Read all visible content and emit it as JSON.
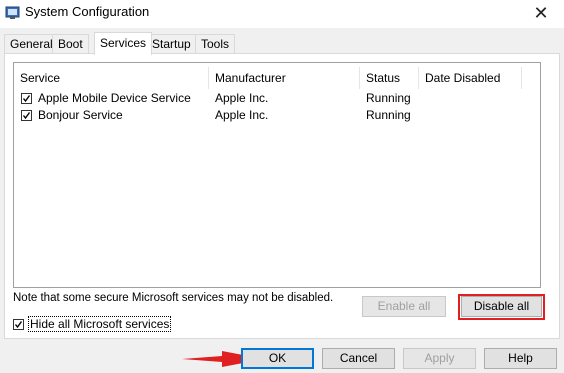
{
  "window": {
    "title": "System Configuration"
  },
  "tabs": [
    {
      "label": "General"
    },
    {
      "label": "Boot"
    },
    {
      "label": "Services"
    },
    {
      "label": "Startup"
    },
    {
      "label": "Tools"
    }
  ],
  "columns": [
    "Service",
    "Manufacturer",
    "Status",
    "Date Disabled"
  ],
  "services": [
    {
      "checked": true,
      "name": "Apple Mobile Device Service",
      "manufacturer": "Apple Inc.",
      "status": "Running",
      "date_disabled": ""
    },
    {
      "checked": true,
      "name": "Bonjour Service",
      "manufacturer": "Apple Inc.",
      "status": "Running",
      "date_disabled": ""
    }
  ],
  "note": "Note that some secure Microsoft services may not be disabled.",
  "buttons": {
    "enable_all": "Enable all",
    "disable_all": "Disable all",
    "ok": "OK",
    "cancel": "Cancel",
    "apply": "Apply",
    "help": "Help"
  },
  "hide_ms": {
    "checked": true,
    "label": "Hide all Microsoft services"
  },
  "colors": {
    "annotation_red": "#e02020",
    "focus_blue": "#0078d7"
  }
}
